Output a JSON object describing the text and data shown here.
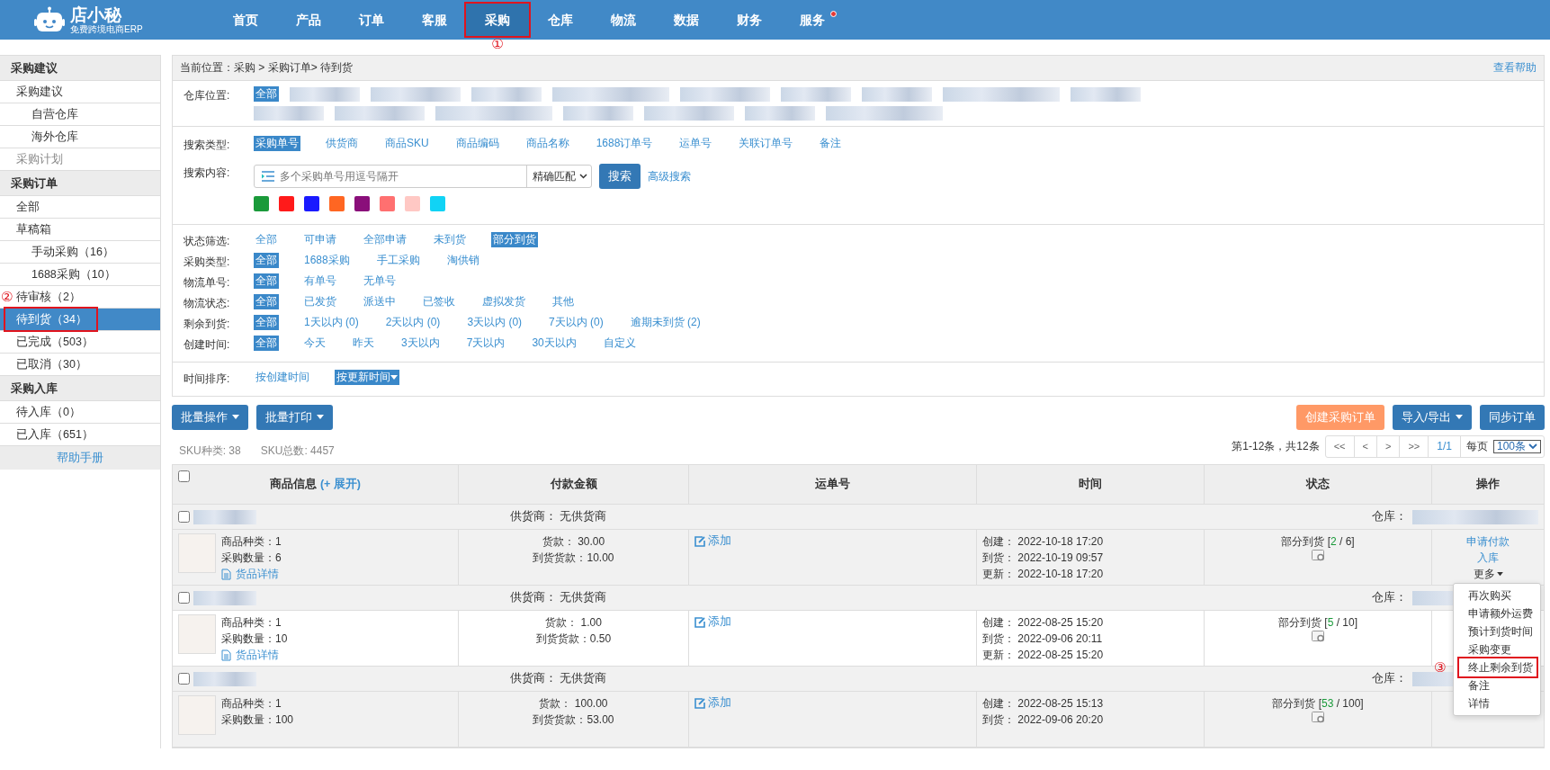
{
  "brand": {
    "name": "店小秘",
    "tagline": "免费跨境电商ERP"
  },
  "nav": [
    {
      "label": "首页",
      "selected": false,
      "dot": false
    },
    {
      "label": "产品",
      "selected": false,
      "dot": false
    },
    {
      "label": "订单",
      "selected": false,
      "dot": false
    },
    {
      "label": "客服",
      "selected": false,
      "dot": false
    },
    {
      "label": "采购",
      "selected": true,
      "dot": false,
      "highlighted": true,
      "marker": "①"
    },
    {
      "label": "仓库",
      "selected": false,
      "dot": false
    },
    {
      "label": "物流",
      "selected": false,
      "dot": false
    },
    {
      "label": "数据",
      "selected": false,
      "dot": false
    },
    {
      "label": "财务",
      "selected": false,
      "dot": false
    },
    {
      "label": "服务",
      "selected": false,
      "dot": true
    }
  ],
  "sidebar": {
    "sections": [
      {
        "title": "采购建议",
        "items": [
          {
            "label": "采购建议",
            "selected": false,
            "disabled": false,
            "children": [
              {
                "label": "自营仓库",
                "selected": false,
                "disabled": false
              },
              {
                "label": "海外仓库",
                "selected": false,
                "disabled": false
              }
            ]
          },
          {
            "label": "采购计划",
            "selected": false,
            "disabled": true
          }
        ]
      },
      {
        "title": "采购订单",
        "items": [
          {
            "label": "全部",
            "selected": false,
            "disabled": false
          },
          {
            "label": "草稿箱",
            "selected": false,
            "disabled": false,
            "children": [
              {
                "label": "手动采购（16）",
                "selected": false,
                "disabled": false
              },
              {
                "label": "1688采购（10）",
                "selected": false,
                "disabled": false
              }
            ]
          },
          {
            "label": "待审核（2）",
            "selected": false,
            "disabled": false
          },
          {
            "label": "待到货（34）",
            "selected": true,
            "disabled": false,
            "highlighted": true,
            "marker": "②"
          },
          {
            "label": "已完成（503）",
            "selected": false,
            "disabled": false
          },
          {
            "label": "已取消（30）",
            "selected": false,
            "disabled": false
          }
        ]
      },
      {
        "title": "采购入库",
        "items": [
          {
            "label": "待入库（0）",
            "selected": false,
            "disabled": false
          },
          {
            "label": "已入库（651）",
            "selected": false,
            "disabled": false
          }
        ]
      }
    ],
    "help": "帮助手册"
  },
  "breadcrumb": {
    "label": "当前位置：",
    "path": "采购 > 采购订单> 待到货",
    "help": "查看帮助"
  },
  "warehouse": {
    "label": "仓库位置:",
    "options": [
      {
        "kind": "text",
        "label": "全部",
        "selected": true
      },
      {
        "kind": "redacted"
      },
      {
        "kind": "redacted"
      },
      {
        "kind": "redacted"
      },
      {
        "kind": "redacted"
      },
      {
        "kind": "redacted"
      },
      {
        "kind": "redacted"
      },
      {
        "kind": "redacted"
      },
      {
        "kind": "redacted"
      },
      {
        "kind": "redacted"
      },
      {
        "kind": "redacted"
      },
      {
        "kind": "redacted"
      },
      {
        "kind": "redacted"
      },
      {
        "kind": "redacted"
      },
      {
        "kind": "redacted"
      },
      {
        "kind": "redacted"
      },
      {
        "kind": "redacted"
      }
    ]
  },
  "search": {
    "type_label": "搜索类型:",
    "types": [
      {
        "label": "采购单号",
        "selected": true
      },
      {
        "label": "供货商",
        "selected": false
      },
      {
        "label": "商品SKU",
        "selected": false
      },
      {
        "label": "商品编码",
        "selected": false
      },
      {
        "label": "商品名称",
        "selected": false
      },
      {
        "label": "1688订单号",
        "selected": false
      },
      {
        "label": "运单号",
        "selected": false
      },
      {
        "label": "关联订单号",
        "selected": false
      },
      {
        "label": "备注",
        "selected": false
      }
    ],
    "content_label": "搜索内容:",
    "placeholder": "多个采购单号用逗号隔开",
    "match": "精确匹配",
    "button": "搜索",
    "advanced": "高级搜索",
    "colors": [
      {
        "color": "#1a9a3a"
      },
      {
        "color": "#ff1a1a"
      },
      {
        "color": "#1a1aff"
      },
      {
        "color": "#ff6622"
      },
      {
        "color": "#8a0f7a"
      },
      {
        "color": "#ff7070"
      },
      {
        "color": "#ffc8c4"
      },
      {
        "color": "#11d3f5"
      }
    ]
  },
  "filters": [
    {
      "label": "状态筛选:",
      "options": [
        {
          "label": "全部",
          "selected": false
        },
        {
          "label": "可申请",
          "selected": false
        },
        {
          "label": "全部申请",
          "selected": false
        },
        {
          "label": "未到货",
          "selected": false
        },
        {
          "label": "部分到货",
          "selected": true
        }
      ]
    },
    {
      "label": "采购类型:",
      "options": [
        {
          "label": "全部",
          "selected": true
        },
        {
          "label": "1688采购",
          "selected": false
        },
        {
          "label": "手工采购",
          "selected": false
        },
        {
          "label": "淘供销",
          "selected": false
        }
      ]
    },
    {
      "label": "物流单号:",
      "options": [
        {
          "label": "全部",
          "selected": true
        },
        {
          "label": "有单号",
          "selected": false
        },
        {
          "label": "无单号",
          "selected": false
        }
      ]
    },
    {
      "label": "物流状态:",
      "options": [
        {
          "label": "全部",
          "selected": true
        },
        {
          "label": "已发货",
          "selected": false
        },
        {
          "label": "派送中",
          "selected": false
        },
        {
          "label": "已签收",
          "selected": false
        },
        {
          "label": "虚拟发货",
          "selected": false
        },
        {
          "label": "其他",
          "selected": false
        }
      ]
    },
    {
      "label": "剩余到货:",
      "options": [
        {
          "label": "全部",
          "selected": true
        },
        {
          "label": "1天以内 (0)",
          "selected": false
        },
        {
          "label": "2天以内 (0)",
          "selected": false
        },
        {
          "label": "3天以内 (0)",
          "selected": false
        },
        {
          "label": "7天以内 (0)",
          "selected": false
        },
        {
          "label": "逾期未到货 (2)",
          "selected": false
        }
      ]
    },
    {
      "label": "创建时间:",
      "options": [
        {
          "label": "全部",
          "selected": true
        },
        {
          "label": "今天",
          "selected": false
        },
        {
          "label": "昨天",
          "selected": false
        },
        {
          "label": "3天以内",
          "selected": false
        },
        {
          "label": "7天以内",
          "selected": false
        },
        {
          "label": "30天以内",
          "selected": false
        },
        {
          "label": "自定义",
          "selected": false
        }
      ]
    }
  ],
  "sort": {
    "label": "时间排序:",
    "options": [
      {
        "label": "按创建时间",
        "selected": false
      },
      {
        "label": "按更新时间",
        "selected": true
      }
    ]
  },
  "actions": {
    "left": [
      {
        "label": "批量操作"
      },
      {
        "label": "批量打印"
      }
    ],
    "right": [
      {
        "label": "创建采购订单",
        "kind": "orange"
      },
      {
        "label": "导入/导出",
        "kind": "dropdown"
      },
      {
        "label": "同步订单",
        "kind": "primary"
      }
    ]
  },
  "stats": [
    {
      "text": "SKU种类: 38"
    },
    {
      "text": "SKU总数: 4457"
    }
  ],
  "pager": {
    "summary": "第1-12条，共12条",
    "buttons": [
      "<<",
      "<",
      ">",
      ">>"
    ],
    "page": "1/1",
    "per_page_label": "每页",
    "per_page": "100条"
  },
  "table": {
    "select_all_checked": false,
    "columns": [
      {
        "label": "商品信息",
        "link": "(+ 展开)"
      },
      {
        "label": "付款金额"
      },
      {
        "label": "运单号"
      },
      {
        "label": "时间"
      },
      {
        "label": "状态"
      },
      {
        "label": "操作"
      }
    ],
    "orders": [
      {
        "supplier": "供货商：  无供货商",
        "warehouse_label": "仓库：",
        "checked": false,
        "kinds": "商品种类：1",
        "qty": "采购数量：6",
        "detail": "货品详情",
        "pay": "货款：  30.00",
        "arrived_pay": "到货货款：10.00",
        "tracking": "添加",
        "created": "创建：  2022-10-18 17:20",
        "arrival": "到货：  2022-10-19 09:57",
        "updated": "更新：  2022-10-18 17:20",
        "status": "部分到货 [",
        "arrived": "2",
        "total": " / 6]",
        "ops": [
          "申请付款",
          "入库"
        ],
        "more": "更多",
        "menu": [
          {
            "label": "再次购买",
            "highlighted": false
          },
          {
            "label": "申请额外运费",
            "highlighted": false
          },
          {
            "label": "预计到货时间",
            "highlighted": false
          },
          {
            "label": "采购变更",
            "highlighted": false
          },
          {
            "label": "终止剩余到货",
            "highlighted": true,
            "marker": "③"
          },
          {
            "label": "备注",
            "highlighted": false
          },
          {
            "label": "详情",
            "highlighted": false
          }
        ]
      },
      {
        "supplier": "供货商：  无供货商",
        "warehouse_label": "仓库：",
        "checked": false,
        "kinds": "商品种类：1",
        "qty": "采购数量：10",
        "detail": "货品详情",
        "pay": "货款：  1.00",
        "arrived_pay": "到货货款：0.50",
        "tracking": "添加",
        "created": "创建：  2022-08-25 15:20",
        "arrival": "到货：  2022-09-06 20:11",
        "updated": "更新：  2022-08-25 15:20",
        "status": "部分到货 [",
        "arrived": "5",
        "total": " / 10]"
      },
      {
        "supplier": "供货商：  无供货商",
        "warehouse_label": "仓库：",
        "checked": false,
        "kinds": "商品种类：1",
        "qty": "采购数量：100",
        "pay": "货款：  100.00",
        "arrived_pay": "到货货款：53.00",
        "tracking": "添加",
        "created": "创建：  2022-08-25 15:13",
        "arrival": "到货：  2022-09-06 20:20",
        "status": "部分到货 [",
        "arrived": "53",
        "total": " / 100]"
      }
    ]
  }
}
